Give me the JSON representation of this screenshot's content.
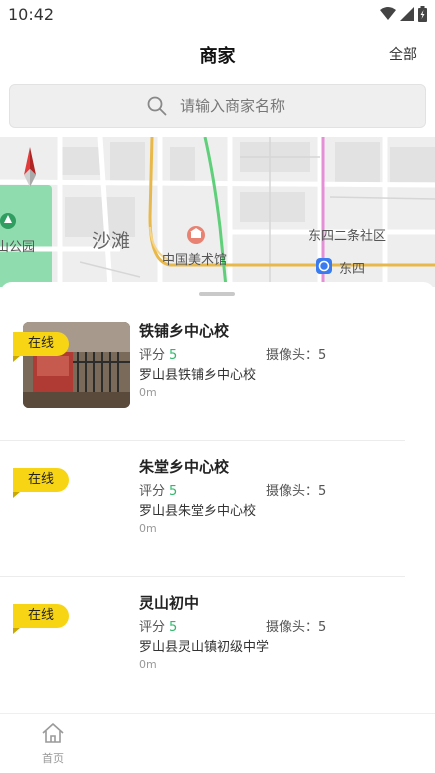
{
  "status_bar": {
    "time": "10:42"
  },
  "header": {
    "title": "商家",
    "all_label": "全部"
  },
  "search": {
    "placeholder": "请输入商家名称"
  },
  "map": {
    "labels": {
      "park": "山公园",
      "shatan": "沙滩",
      "museum": "中国美术馆",
      "community": "东四二条社区",
      "dongsi": "东四"
    }
  },
  "merchants": [
    {
      "status": "在线",
      "name": "铁铺乡中心校",
      "score_label": "评分",
      "score": "5",
      "camera_label": "摄像头：",
      "camera_count": "5",
      "address": "罗山县铁铺乡中心校",
      "distance": "0m"
    },
    {
      "status": "在线",
      "name": "朱堂乡中心校",
      "score_label": "评分",
      "score": "5",
      "camera_label": "摄像头：",
      "camera_count": "5",
      "address": "罗山县朱堂乡中心校",
      "distance": "0m"
    },
    {
      "status": "在线",
      "name": "灵山初中",
      "score_label": "评分",
      "score": "5",
      "camera_label": "摄像头：",
      "camera_count": "5",
      "address": "罗山县灵山镇初级中学",
      "distance": "0m"
    }
  ],
  "bottom_nav": {
    "home_label": "首页"
  },
  "colors": {
    "online_badge": "#f7d515",
    "score": "#2fb96b",
    "map_green": "#7fd3a0",
    "map_road_yellow": "#e8b94a",
    "metro_blue": "#3b7bf0"
  }
}
